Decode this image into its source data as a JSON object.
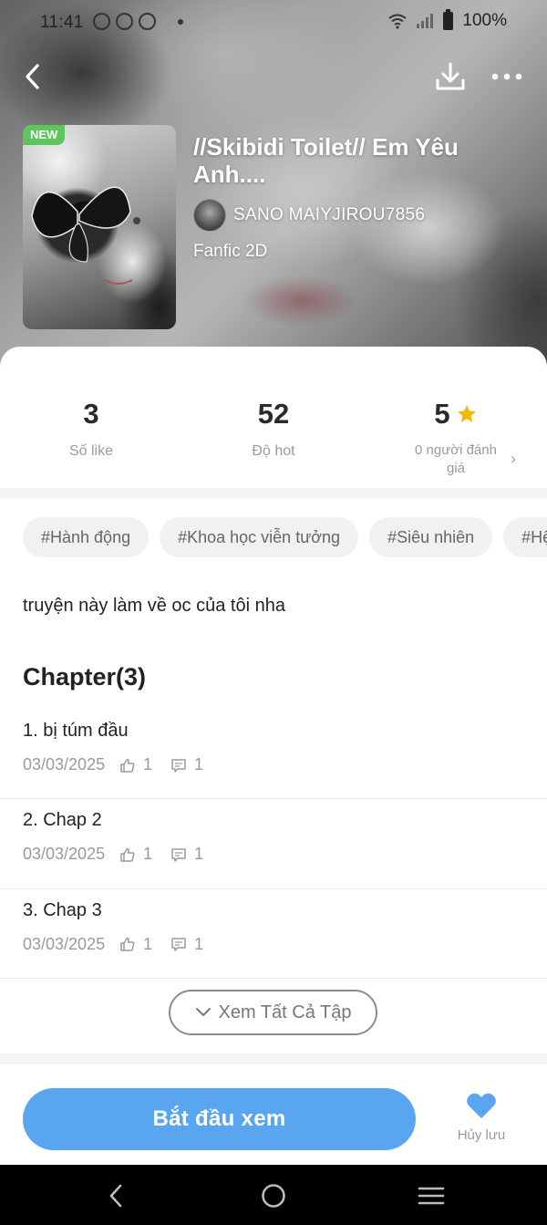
{
  "status_bar": {
    "time": "11:41",
    "battery": "100%"
  },
  "book": {
    "badge": "NEW",
    "title": "//Skibidi Toilet// Em Yêu Anh....",
    "author": "SANO MAIYJIROU7856",
    "genre": "Fanfic 2D"
  },
  "stats": {
    "likes": {
      "value": "3",
      "label": "Số like"
    },
    "hot": {
      "value": "52",
      "label": "Độ hot"
    },
    "rating": {
      "value": "5",
      "label": "0 người đánh giá"
    }
  },
  "tags": [
    "#Hành động",
    "#Khoa học viễn tưởng",
    "#Siêu nhiên",
    "#Hệ thống"
  ],
  "description": "truyện này làm về oc của tôi nha",
  "chapters_heading": "Chapter(3)",
  "chapters": [
    {
      "title": "1. bị túm đầu",
      "date": "03/03/2025",
      "likes": "1",
      "comments": "1"
    },
    {
      "title": "2. Chap 2",
      "date": "03/03/2025",
      "likes": "1",
      "comments": "1"
    },
    {
      "title": "3. Chap 3",
      "date": "03/03/2025",
      "likes": "1",
      "comments": "1"
    }
  ],
  "see_all_label": "Xem Tất Cả Tập",
  "start_label": "Bắt đầu xem",
  "save_label": "Hủy lưu",
  "colors": {
    "accent": "#5aa5f0",
    "badge": "#5cc65c",
    "star": "#f5b800"
  }
}
